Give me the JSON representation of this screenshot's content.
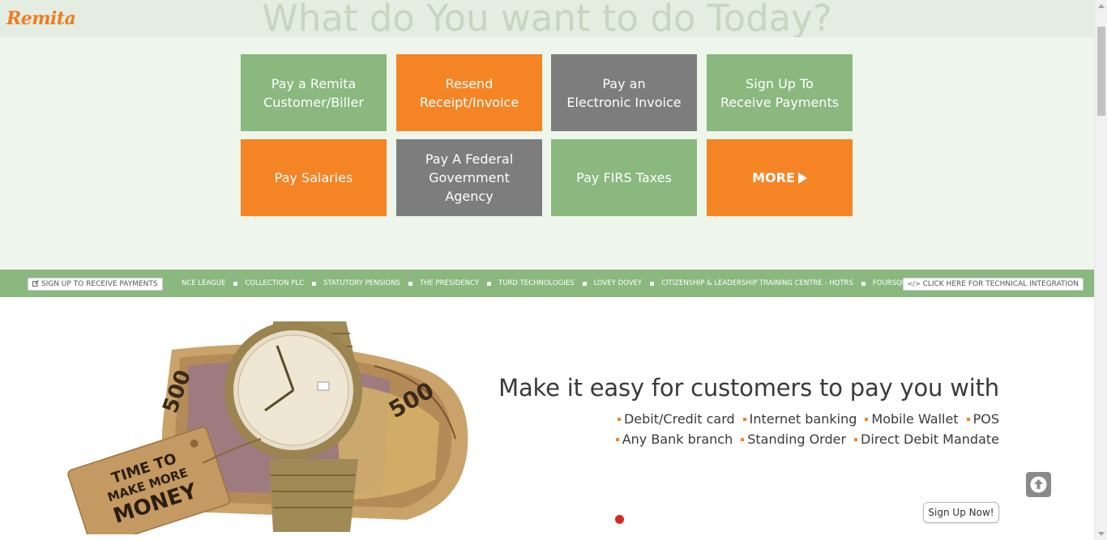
{
  "brand": {
    "logo_text": "Remita",
    "logo_color": "#ef7d22"
  },
  "headline": "What do You want to do Today?",
  "colors": {
    "green": "#8ab87f",
    "orange": "#f58425",
    "gray": "#7d7d7d"
  },
  "tiles": [
    {
      "label": "Pay a Remita\nCustomer/Biller",
      "color": "green"
    },
    {
      "label": "Resend\nReceipt/Invoice",
      "color": "orange"
    },
    {
      "label": "Pay an\nElectronic Invoice",
      "color": "gray"
    },
    {
      "label": "Sign Up To\nReceive Payments",
      "color": "green"
    },
    {
      "label": "Pay Salaries",
      "color": "orange"
    },
    {
      "label": "Pay A Federal\nGovernment\nAgency",
      "color": "gray"
    },
    {
      "label": "Pay FIRS Taxes",
      "color": "green"
    },
    {
      "label": "MORE",
      "color": "orange"
    }
  ],
  "ticker": {
    "left_button": "SIGN UP TO RECEIVE PAYMENTS",
    "right_button": "CLICK HERE FOR TECHNICAL INTEGRATION",
    "items": [
      "NCE LEAGUE",
      "COLLECTION PLC",
      "STATUTORY PENSIONS",
      "THE PRESIDENCY",
      "TURD TECHNOLOGIES",
      "LOVEY DOVEY",
      "CITIZENSHIP & LEADERSHIP TRAINING CENTRE - HQTRS",
      "FOURSQUARE DISTRCT"
    ]
  },
  "promo": {
    "tag_line1": "TIME TO",
    "tag_line2": "MAKE MORE",
    "tag_line3": "MONEY",
    "note_text": "500",
    "title": "Make it easy for customers to pay you with",
    "methods_line1": [
      "Debit/Credit card",
      "Internet banking",
      "Mobile Wallet",
      "POS"
    ],
    "methods_line2": [
      "Any Bank branch",
      "Standing Order",
      "Direct Debit Mandate"
    ],
    "cta": "Sign Up Now!"
  },
  "icons": {
    "back_to_top": "arrow-up-circle-icon",
    "more": "play-triangle-icon",
    "edit": "edit-icon",
    "code": "code-icon"
  }
}
